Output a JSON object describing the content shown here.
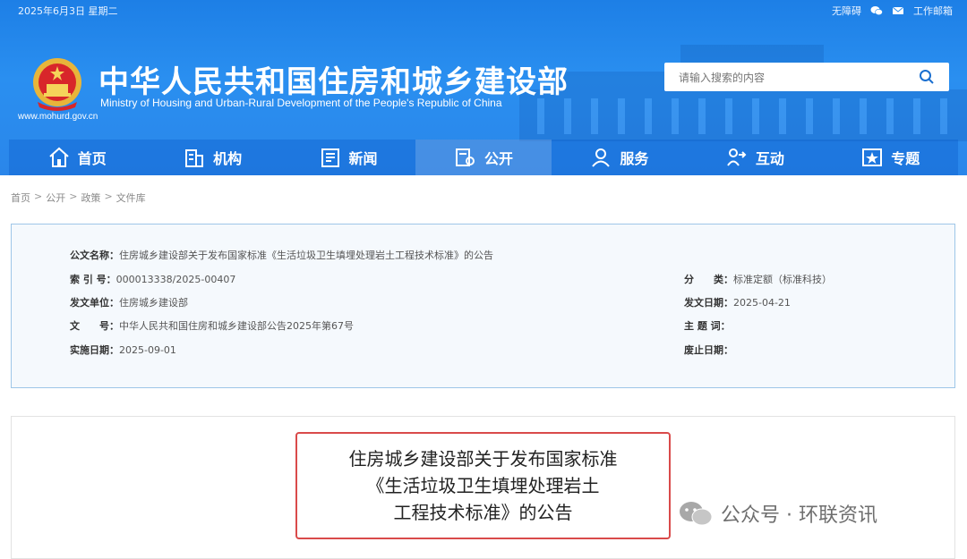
{
  "topbar": {
    "date": "2025年6月3日 星期二",
    "accessibility": "无障碍",
    "mail": "工作邮箱"
  },
  "header": {
    "title": "中华人民共和国住房和城乡建设部",
    "subtitle": "Ministry of Housing and Urban-Rural Development of the People's Republic of China",
    "url": "www.mohurd.gov.cn"
  },
  "search": {
    "placeholder": "请输入搜索的内容"
  },
  "nav": [
    {
      "label": "首页",
      "icon": "home-icon"
    },
    {
      "label": "机构",
      "icon": "building-icon"
    },
    {
      "label": "新闻",
      "icon": "news-icon"
    },
    {
      "label": "公开",
      "icon": "disclosure-icon",
      "active": true
    },
    {
      "label": "服务",
      "icon": "service-icon"
    },
    {
      "label": "互动",
      "icon": "interaction-icon"
    },
    {
      "label": "专题",
      "icon": "topic-icon"
    }
  ],
  "breadcrumb": [
    "首页",
    "公开",
    "政策",
    "文件库"
  ],
  "info": {
    "doc_name_label": "公文名称：",
    "doc_name": "住房城乡建设部关于发布国家标准《生活垃圾卫生填埋处理岩土工程技术标准》的公告",
    "index_label": "索 引 号：",
    "index": "000013338/2025-00407",
    "category_label": "分　　类：",
    "category": "标准定额（标准科技）",
    "issuer_label": "发文单位：",
    "issuer": "住房城乡建设部",
    "issue_date_label": "发文日期：",
    "issue_date": "2025-04-21",
    "doc_no_label": "文　　号：",
    "doc_no": "中华人民共和国住房和城乡建设部公告2025年第67号",
    "keywords_label": "主 题 词：",
    "keywords": "",
    "effective_label": "实施日期：",
    "effective": "2025-09-01",
    "abolish_label": "废止日期：",
    "abolish": ""
  },
  "article": {
    "title_lines": [
      "住房城乡建设部关于发布国家标准",
      "《生活垃圾卫生填埋处理岩土",
      "工程技术标准》的公告"
    ]
  },
  "watermark": {
    "text": "公众号 · 环联资讯"
  },
  "colors": {
    "header_blue": "#2a8ff0",
    "accent_red": "#d94a4a",
    "info_border": "#9ec6e8"
  }
}
